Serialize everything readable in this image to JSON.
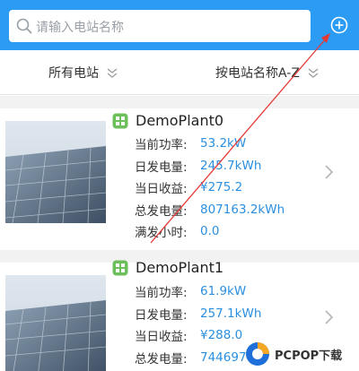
{
  "search": {
    "placeholder": "请输入电站名称"
  },
  "filters": {
    "station": "所有电站",
    "sort": "按电站名称A-Z"
  },
  "plants": [
    {
      "name": "DemoPlant0",
      "rows": [
        {
          "label": "当前功率:",
          "value": "53.2kW"
        },
        {
          "label": "日发电量:",
          "value": "245.7kWh"
        },
        {
          "label": "当日收益:",
          "value": "¥275.2"
        },
        {
          "label": "总发电量:",
          "value": "807163.2kWh"
        },
        {
          "label": "满发小时:",
          "value": "0.0"
        }
      ]
    },
    {
      "name": "DemoPlant1",
      "rows": [
        {
          "label": "当前功率:",
          "value": "61.9kW"
        },
        {
          "label": "日发电量:",
          "value": "257.1kWh"
        },
        {
          "label": "当日收益:",
          "value": "¥288.0"
        },
        {
          "label": "总发电量:",
          "value": "744697"
        }
      ]
    }
  ],
  "watermark": {
    "text": "PCPOP下载"
  },
  "colors": {
    "header": "#2b9bf4",
    "value": "#2b8fe0",
    "annotation_arrow": "#e53935"
  },
  "icons": {
    "search": "search-icon",
    "add": "plus-circle-icon",
    "chevron": "double-chevron-down-icon",
    "plant": "plant-status-icon",
    "arrow": "chevron-right-icon"
  }
}
